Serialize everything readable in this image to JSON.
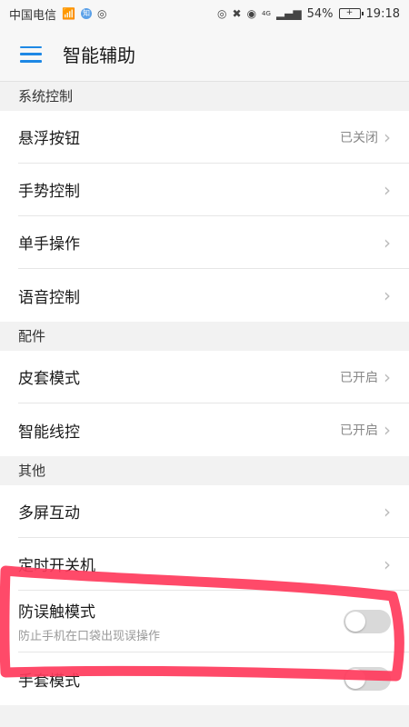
{
  "status_bar": {
    "carrier": "中国电信",
    "battery": "54%",
    "time": "19:18",
    "network": "4G"
  },
  "header": {
    "title": "智能辅助",
    "menu_icon": "menu-icon"
  },
  "sections": {
    "system": {
      "title": "系统控制",
      "items": [
        {
          "label": "悬浮按钮",
          "value": "已关闭"
        },
        {
          "label": "手势控制",
          "value": ""
        },
        {
          "label": "单手操作",
          "value": ""
        },
        {
          "label": "语音控制",
          "value": ""
        }
      ]
    },
    "accessories": {
      "title": "配件",
      "items": [
        {
          "label": "皮套模式",
          "value": "已开启"
        },
        {
          "label": "智能线控",
          "value": "已开启"
        }
      ]
    },
    "other": {
      "title": "其他",
      "items": [
        {
          "label": "多屏互动",
          "value": ""
        },
        {
          "label": "定时开关机",
          "value": ""
        },
        {
          "label": "防误触模式",
          "sub": "防止手机在口袋出现误操作",
          "toggle": false
        },
        {
          "label": "手套模式",
          "toggle": false
        }
      ]
    }
  },
  "colors": {
    "accent": "#1e88e5",
    "annotation": "#ff3b5c"
  }
}
